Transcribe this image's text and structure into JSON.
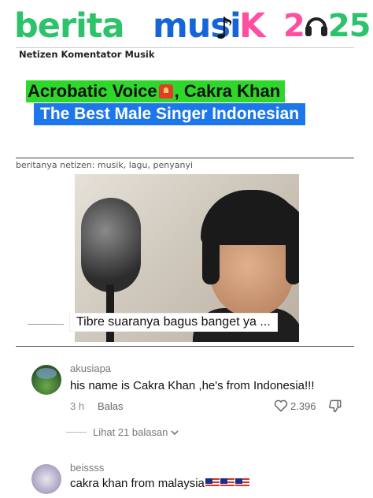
{
  "logo": {
    "word1": "berita",
    "word2": "musi",
    "note": "♪",
    "word3": "K",
    "year_a": "2",
    "year_b": "25",
    "headphone_icon": "headphones-icon"
  },
  "header": {
    "subtitle": "Netizen Komentator Musik"
  },
  "headline": {
    "line1_a": "Acrobatic Voice",
    "line1_b": ", Cakra Khan",
    "line2": "The Best Male Singer Indonesian"
  },
  "tags_line": "beritanya netizen: musik, lagu, penyanyi",
  "video": {
    "caption": "Tibre suaranya bagus banget ya ..."
  },
  "comments": [
    {
      "username": "akusiapa",
      "text": "his name is Cakra Khan ,he's from Indonesia!!!",
      "time": "3 h",
      "reply_label": "Balas",
      "likes": "2.396",
      "view_replies": "Lihat 21 balasan"
    },
    {
      "username": "beissss",
      "text": "cakra khan from malaysia"
    }
  ],
  "colors": {
    "green_highlight": "#2fd72a",
    "blue_highlight": "#1d77ea",
    "logo_green": "#2cc36b",
    "logo_blue": "#1565d8",
    "logo_pink": "#ff4fa3"
  }
}
